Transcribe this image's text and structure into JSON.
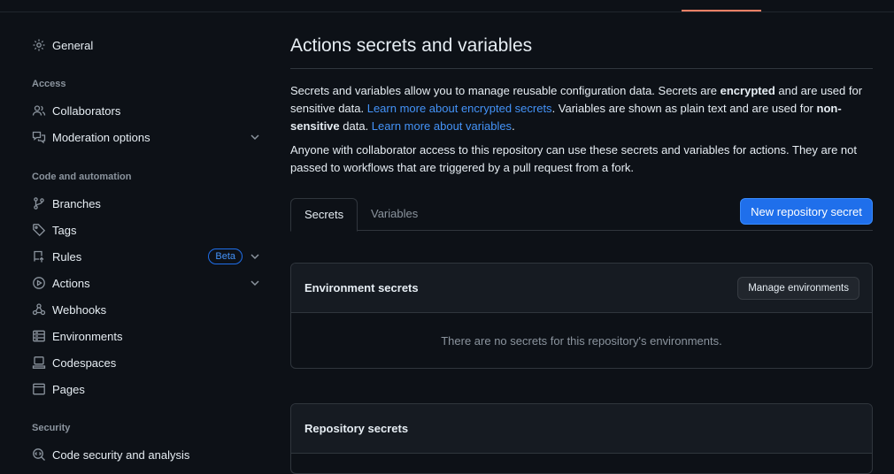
{
  "sidebar": {
    "general": "General",
    "headings": {
      "access": "Access",
      "code_automation": "Code and automation",
      "security": "Security"
    },
    "items": {
      "collaborators": "Collaborators",
      "moderation": "Moderation options",
      "branches": "Branches",
      "tags": "Tags",
      "rules": "Rules",
      "rules_badge": "Beta",
      "actions": "Actions",
      "webhooks": "Webhooks",
      "environments": "Environments",
      "codespaces": "Codespaces",
      "pages": "Pages",
      "code_security": "Code security and analysis"
    }
  },
  "main": {
    "title": "Actions secrets and variables",
    "intro": {
      "p1_a": "Secrets and variables allow you to manage reusable configuration data. Secrets are ",
      "p1_encrypted": "encrypted",
      "p1_b": " and are used for sensitive data. ",
      "p1_link1": "Learn more about encrypted secrets",
      "p1_c": ". Variables are shown as plain text and are used for ",
      "p1_nonsensitive": "non-sensitive",
      "p1_d": " data. ",
      "p1_link2": "Learn more about variables",
      "p1_e": "."
    },
    "notice": "Anyone with collaborator access to this repository can use these secrets and variables for actions. They are not passed to workflows that are triggered by a pull request from a fork.",
    "tabs": [
      "Secrets",
      "Variables"
    ],
    "new_secret_button": "New repository secret",
    "env_secrets": {
      "title": "Environment secrets",
      "manage_button": "Manage environments",
      "empty": "There are no secrets for this repository's environments."
    },
    "repo_secrets": {
      "title": "Repository secrets"
    }
  }
}
